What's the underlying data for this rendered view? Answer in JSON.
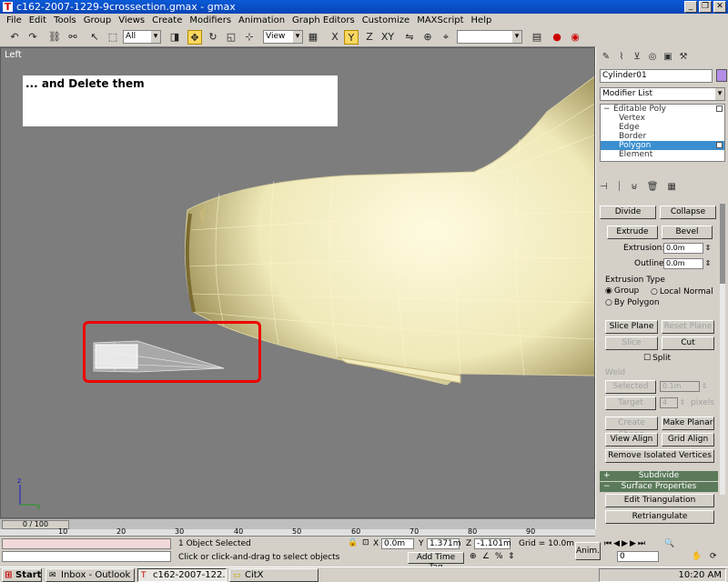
{
  "window": {
    "title": "c162-2007-1229-9crossection.gmax - gmax"
  },
  "menu": [
    "File",
    "Edit",
    "Tools",
    "Group",
    "Views",
    "Create",
    "Modifiers",
    "Animation",
    "Graph Editors",
    "Customize",
    "MAXScript",
    "Help"
  ],
  "toolbar": {
    "selection_filter": "All",
    "ref_coord": "View",
    "named_selection": ""
  },
  "viewport": {
    "label": "Left",
    "note": "... and Delete them"
  },
  "command_panel": {
    "object_name": "Cylinder01",
    "modifier_list": "Modifier List",
    "stack": [
      {
        "label": "Editable Poly",
        "root": true
      },
      {
        "label": "Vertex"
      },
      {
        "label": "Edge"
      },
      {
        "label": "Border"
      },
      {
        "label": "Polygon",
        "selected": true
      },
      {
        "label": "Element"
      }
    ],
    "buttons": {
      "divide": "Divide",
      "collapse": "Collapse",
      "extrude": "Extrude",
      "bevel": "Bevel",
      "slice_plane": "Slice Plane",
      "reset_plane": "Reset Plane",
      "slice": "Slice",
      "cut": "Cut",
      "selected": "Selected",
      "target": "Target",
      "create_shape": "Create Shape",
      "make_planar": "Make Planar",
      "view_align": "View Align",
      "grid_align": "Grid Align",
      "remove_isolated": "Remove Isolated Vertices",
      "edit_triangulation": "Edit Triangulation",
      "retriangulate": "Retriangulate"
    },
    "labels": {
      "extrusion": "Extrusion:",
      "outline": "Outline:",
      "extrusion_type": "Extrusion Type",
      "group": "Group",
      "local_normal": "Local Normal",
      "by_polygon": "By Polygon",
      "split": "Split",
      "weld": "Weld",
      "pixels": "pixels"
    },
    "values": {
      "extrusion": "0.0m",
      "outline": "0.0m",
      "weld_threshold": "0.1m",
      "target_pixels": "4"
    },
    "rollouts": {
      "subdivide": "Subdivide",
      "surface_properties": "Surface Properties"
    }
  },
  "timeline": {
    "slider": "0 / 100",
    "ticks": [
      "10",
      "20",
      "30",
      "40",
      "50",
      "60",
      "70",
      "80",
      "90"
    ]
  },
  "status": {
    "selection": "1 Object Selected",
    "prompt": "Click or click-and-drag to select objects",
    "x_label": "X",
    "x_value": "0.0m",
    "y_label": "Y",
    "y_value": "1.371m",
    "z_label": "Z",
    "z_value": "-1.101m",
    "grid": "Grid = 10.0m",
    "add_time_tag": "Add Time Tag",
    "anim": "Anim.",
    "frame": "0"
  },
  "taskbar": {
    "start": "Start",
    "tasks": [
      "Inbox - Outlook E...",
      "c162-2007-122...",
      "CitX"
    ],
    "clock": "10:20 AM"
  },
  "colors": {
    "model_fill": "#efe8b8",
    "note_bg": "#ffffff",
    "highlight": "#e00000"
  }
}
